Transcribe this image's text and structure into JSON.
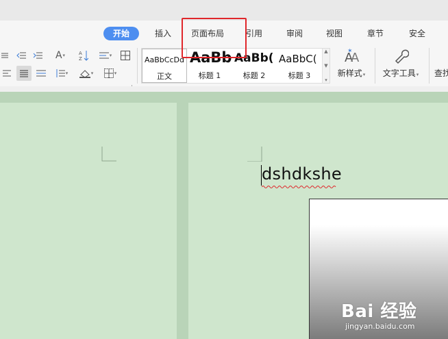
{
  "ribbon": {
    "tabs": [
      {
        "label": "开始",
        "active": true
      },
      {
        "label": "插入"
      },
      {
        "label": "页面布局"
      },
      {
        "label": "引用"
      },
      {
        "label": "审阅"
      },
      {
        "label": "视图"
      },
      {
        "label": "章节"
      },
      {
        "label": "安全"
      }
    ],
    "styles": [
      {
        "preview": "AaBbCcDd",
        "label": "正文"
      },
      {
        "preview": "AaBb",
        "label": "标题 1"
      },
      {
        "preview": "AaBb(",
        "label": "标题 2"
      },
      {
        "preview": "AaBbC(",
        "label": "标题 3"
      }
    ],
    "new_style_label": "新样式",
    "text_tools_label": "文字工具",
    "find_label": "查找"
  },
  "document": {
    "text": "dshdkshe"
  },
  "watermark": {
    "logo": "Bai 经验",
    "url": "jingyan.baidu.com"
  },
  "colors": {
    "accent": "#4d8ef0",
    "highlight": "#e0262a",
    "page": "#cfe6cd"
  }
}
